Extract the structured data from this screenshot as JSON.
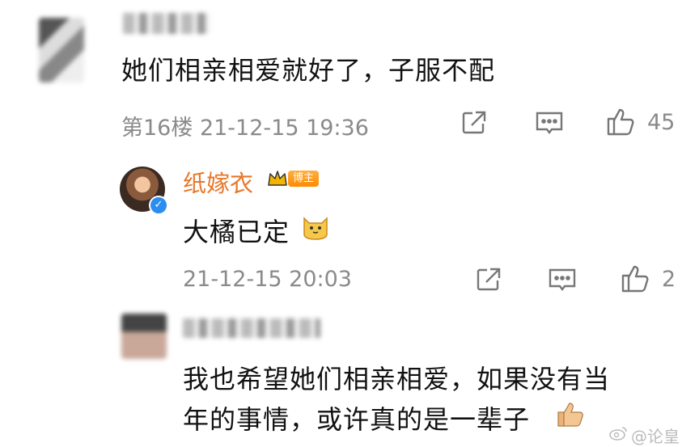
{
  "comment1": {
    "text": "她们相亲相爱就好了，子服不配",
    "floor_time": "第16楼 21-12-15 19:36",
    "likes": "45"
  },
  "reply": {
    "author": "纸嫁衣",
    "badge": "博主",
    "text": "大橘已定",
    "time": "21-12-15 20:03",
    "likes": "2"
  },
  "comment2": {
    "line1": "我也希望她们相亲相爱，如果没有当",
    "line2": "年的事情，或许真的是一辈子"
  },
  "watermark": "@论皇",
  "icons": [
    "share-icon",
    "comment-icon",
    "like-icon",
    "crown-icon",
    "verified-icon",
    "cat-emoji-icon",
    "thumbs-up-emoji-icon",
    "weibo-logo-icon"
  ],
  "colors": {
    "author": "#e8772a",
    "meta": "#8a8a8a",
    "verified": "#2b8df0"
  }
}
